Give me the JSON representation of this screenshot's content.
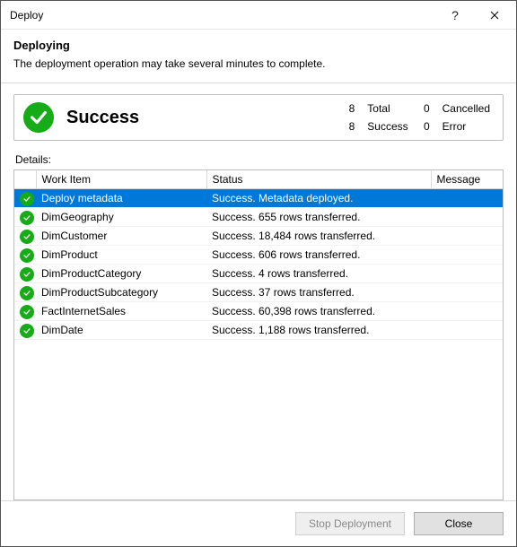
{
  "window": {
    "title": "Deploy"
  },
  "header": {
    "heading": "Deploying",
    "subtext": "The deployment operation may take several minutes to complete."
  },
  "summary": {
    "status_word": "Success",
    "stats": {
      "total_n": "8",
      "total_label": "Total",
      "cancelled_n": "0",
      "cancelled_label": "Cancelled",
      "success_n": "8",
      "success_label": "Success",
      "error_n": "0",
      "error_label": "Error"
    }
  },
  "details_label": "Details:",
  "columns": {
    "icon": "",
    "work_item": "Work Item",
    "status": "Status",
    "message": "Message"
  },
  "rows": [
    {
      "work_item": "Deploy metadata",
      "status": "Success. Metadata deployed.",
      "message": "",
      "selected": true
    },
    {
      "work_item": "DimGeography",
      "status": "Success. 655 rows transferred.",
      "message": "",
      "selected": false
    },
    {
      "work_item": "DimCustomer",
      "status": "Success. 18,484 rows transferred.",
      "message": "",
      "selected": false
    },
    {
      "work_item": "DimProduct",
      "status": "Success. 606 rows transferred.",
      "message": "",
      "selected": false
    },
    {
      "work_item": "DimProductCategory",
      "status": "Success. 4 rows transferred.",
      "message": "",
      "selected": false
    },
    {
      "work_item": "DimProductSubcategory",
      "status": "Success. 37 rows transferred.",
      "message": "",
      "selected": false
    },
    {
      "work_item": "FactInternetSales",
      "status": "Success. 60,398 rows transferred.",
      "message": "",
      "selected": false
    },
    {
      "work_item": "DimDate",
      "status": "Success. 1,188 rows transferred.",
      "message": "",
      "selected": false
    }
  ],
  "buttons": {
    "stop": "Stop Deployment",
    "close": "Close"
  }
}
